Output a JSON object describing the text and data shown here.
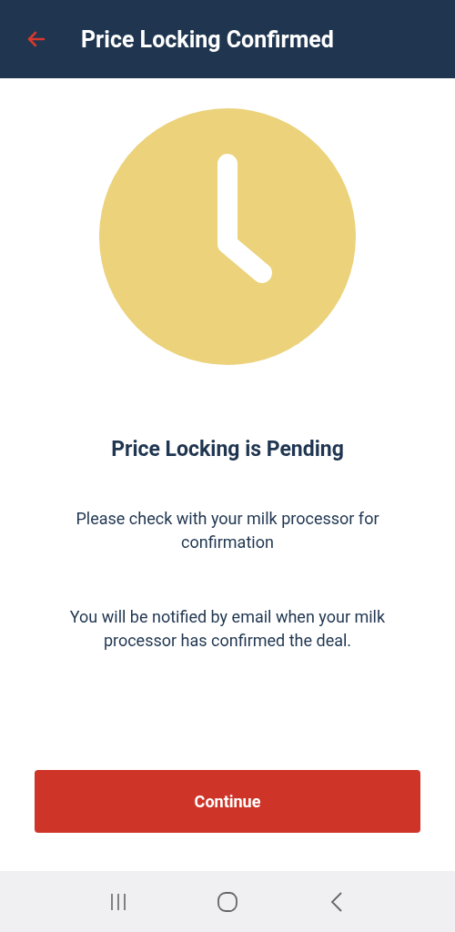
{
  "header": {
    "title": "Price Locking Confirmed"
  },
  "status": {
    "heading": "Price Locking is Pending",
    "messages": [
      "Please check with your milk processor for confirmation",
      "You will be notified by email when your milk processor has confirmed the deal."
    ]
  },
  "button": {
    "label": "Continue"
  }
}
